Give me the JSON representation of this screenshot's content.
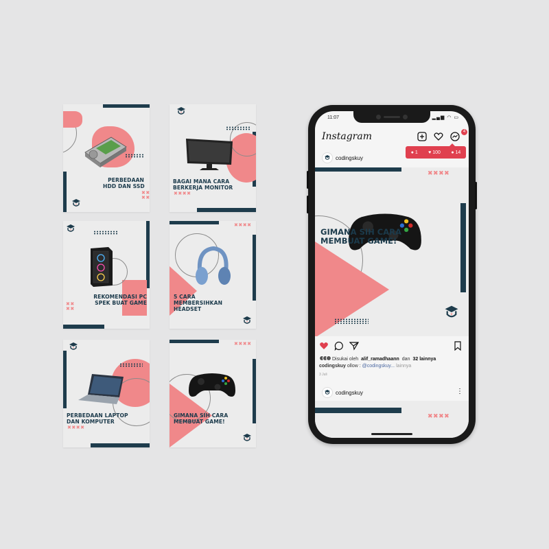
{
  "feed_cards": [
    {
      "title": "PERBEDAAN\nHDD DAN SSD",
      "marks": "✖✖\n✖✖"
    },
    {
      "title": "BAGAI MANA CARA\nBERKERJA MONITOR",
      "marks": "✖✖✖✖"
    },
    {
      "title": "REKOMENDASI PC\nSPEK BUAT GAME",
      "marks": "✖✖\n✖✖"
    },
    {
      "title": "5 CARA\nMEMBERSIHKAN\nHEADSET",
      "marks": "✖✖✖✖"
    },
    {
      "title": "PERBEDAAN LAPTOP\nDAN KOMPUTER",
      "marks": "✖✖✖✖"
    },
    {
      "title": "GIMANA SIH CARA\nMEMBUAT GAME!",
      "marks": "✖✖✖✖"
    }
  ],
  "phone": {
    "status": {
      "time": "11:07"
    },
    "app": {
      "logo": "Instagram",
      "icons": [
        "new-post-icon",
        "heart-icon",
        "messenger-icon"
      ],
      "messenger_badge": "4",
      "notifications": {
        "comments": "1",
        "likes": "100",
        "followers": "14"
      }
    },
    "post": {
      "username": "codingskuy",
      "title": "GIMANA SIH CARA\nMEMBUAT GAME!",
      "marks": "✖✖✖✖",
      "liked_prefix": "Disukai oleh",
      "liked_user": "alif_ramadhaann",
      "liked_mid": "dan",
      "liked_count": "32 lainnya",
      "caption_user": "codingskuy",
      "caption_text": "ollow : ",
      "caption_link": "@codingskuy...",
      "caption_more": "lainnya",
      "date": "3 Juli"
    },
    "post2": {
      "username": "codingskuy",
      "marks": "✖✖✖✖"
    }
  },
  "colors": {
    "accent_pink": "#f0888a",
    "navy": "#1e3c4c",
    "ig_red": "#e0404f"
  }
}
